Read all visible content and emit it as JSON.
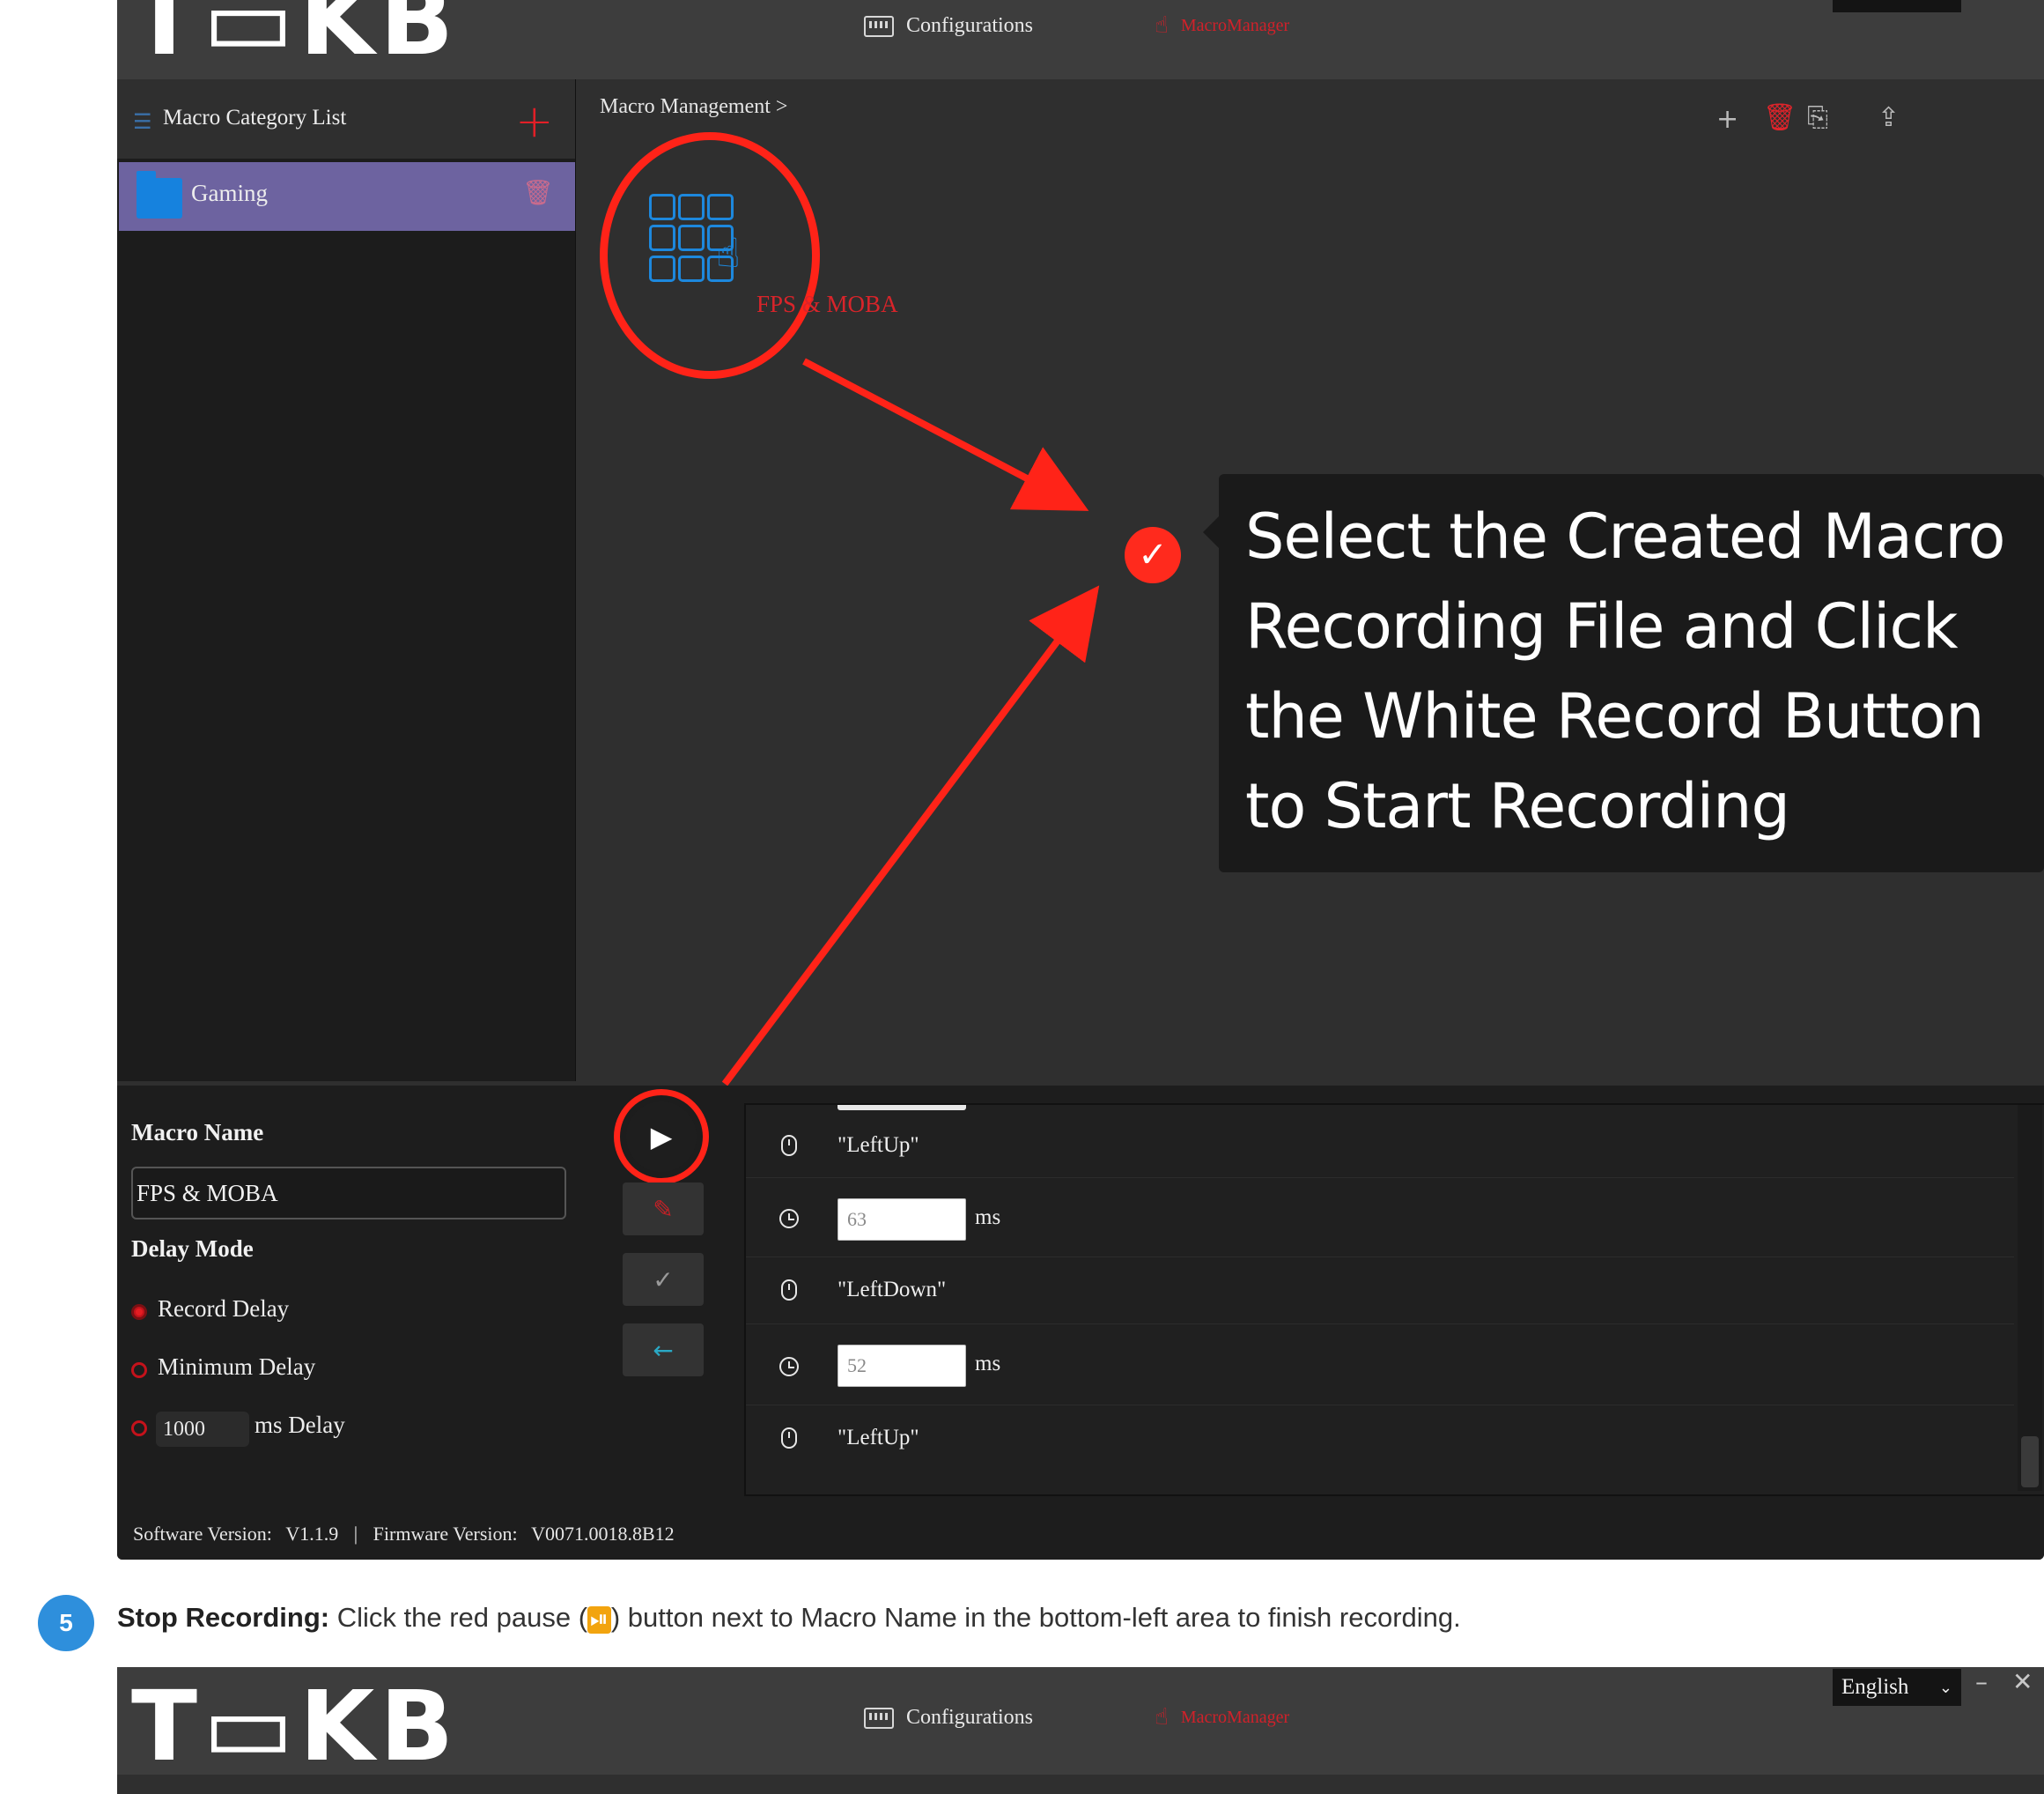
{
  "app": {
    "logo_text": "T▭KB",
    "nav": {
      "configurations": "Configurations",
      "macro_manager": "MacroManager"
    },
    "language": "English",
    "sidebar": {
      "title": "Macro Category List",
      "items": [
        {
          "label": "Gaming"
        }
      ]
    },
    "breadcrumb": "Macro Management >",
    "macro_tile": {
      "label": "FPS & MOBA"
    },
    "macro_name_label": "Macro Name",
    "macro_name_value": "FPS & MOBA",
    "delay_mode_label": "Delay Mode",
    "delay_options": {
      "record": "Record Delay",
      "minimum": "Minimum Delay",
      "custom_value": "1000",
      "custom_suffix": "ms Delay"
    },
    "events": [
      {
        "type": "mouse",
        "text": "\"LeftUp\""
      },
      {
        "type": "delay",
        "value": "63",
        "unit": "ms"
      },
      {
        "type": "mouse",
        "text": "\"LeftDown\""
      },
      {
        "type": "delay",
        "value": "52",
        "unit": "ms"
      },
      {
        "type": "mouse",
        "text": "\"LeftUp\""
      }
    ],
    "version": {
      "software_label": "Software Version:",
      "software_value": "V1.1.9",
      "separator": "|",
      "firmware_label": "Firmware Version:",
      "firmware_value": "V0071.0018.8B12"
    }
  },
  "callout": {
    "lines": [
      "Select the Created Macro",
      "Recording File and Click",
      "the White Record Button",
      "to Start Recording"
    ]
  },
  "step": {
    "number": "5",
    "title": "Stop Recording:",
    "text_before": " Click the red pause (",
    "glyph": "⏯",
    "text_after": ") button next to Macro Name in the bottom-left area to finish recording."
  },
  "colors": {
    "accent_red": "#e2202b",
    "selected_row": "#6d63a0",
    "step_badge": "#2e8fdc"
  }
}
